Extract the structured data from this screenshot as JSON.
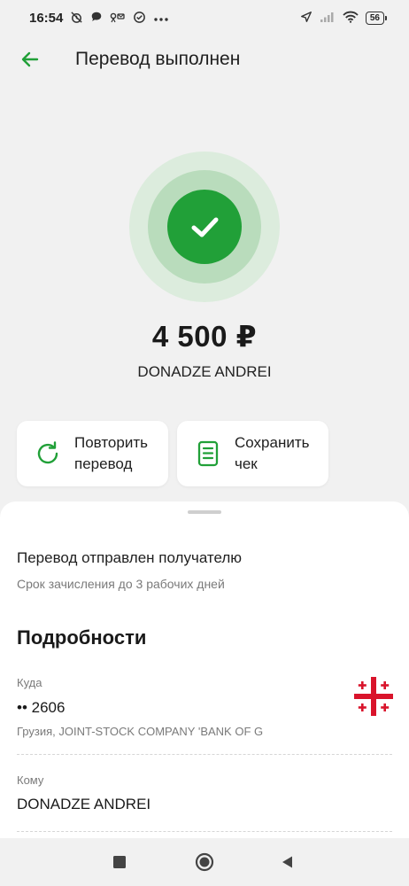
{
  "status_bar": {
    "time": "16:54",
    "battery": "56",
    "icons": [
      "alarm-off-icon",
      "chat-icon",
      "voicemail-icon",
      "check-circle-icon",
      "more-icon",
      "location-icon",
      "signal-icon",
      "wifi-icon",
      "battery-icon"
    ]
  },
  "header": {
    "title": "Перевод выполнен",
    "back_icon": "arrow-left-icon"
  },
  "transfer": {
    "amount": "4 500 ₽",
    "recipient": "DONADZE ANDREI",
    "status_icon": "check-icon"
  },
  "actions": [
    {
      "label": "Повторить\nперевод",
      "icon": "repeat-icon"
    },
    {
      "label": "Сохранить\nчек",
      "icon": "receipt-icon"
    }
  ],
  "sheet": {
    "sent_title": "Перевод отправлен получателю",
    "sent_subtitle": "Срок зачисления до 3 рабочих дней",
    "details_heading": "Подробности",
    "to_label": "Куда",
    "to_value": "•• 2606",
    "to_sub": "Грузия, JOINT-STOCK COMPANY 'BANK OF G",
    "to_flag_icon": "georgia-flag-icon",
    "whom_label": "Кому",
    "whom_value": "DONADZE ANDREI"
  },
  "colors": {
    "accent": "#21a038",
    "ring_outer": "#dcecdd",
    "ring_mid": "#b9dcbc",
    "background": "#f1f1f1",
    "flag_red": "#d9142b"
  },
  "nav": {
    "icons": [
      "recents-square-icon",
      "home-circle-icon",
      "back-triangle-icon"
    ]
  }
}
